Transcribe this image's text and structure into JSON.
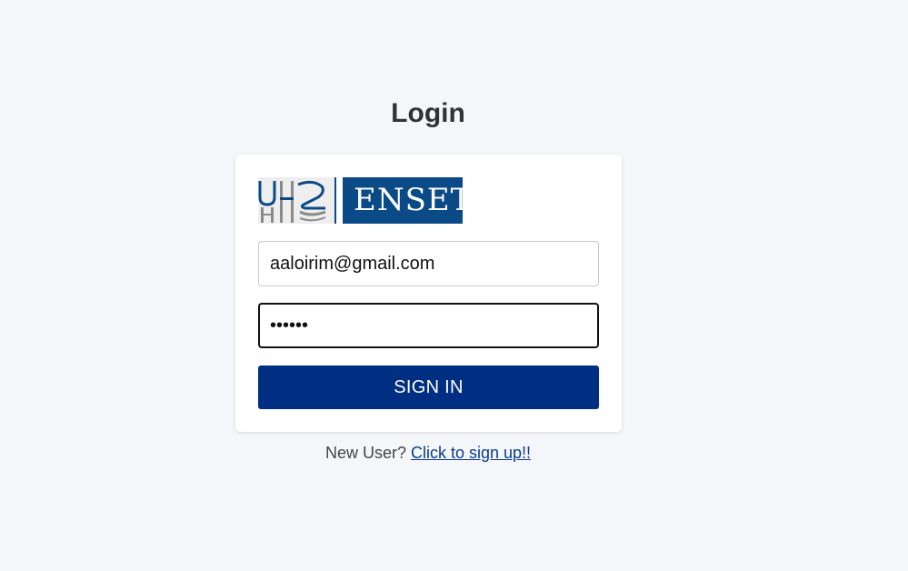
{
  "page": {
    "title": "Login"
  },
  "logo": {
    "left_mark": "UH2",
    "text": "ENSET",
    "brand_color": "#0a4a86"
  },
  "form": {
    "email_value": "aaloirim@gmail.com",
    "password_value": "aaaaaa",
    "signin_label": "SIGN IN",
    "signin_color": "#002e83"
  },
  "footer": {
    "prompt": "New User? ",
    "link_text": "Click to sign up!!"
  }
}
